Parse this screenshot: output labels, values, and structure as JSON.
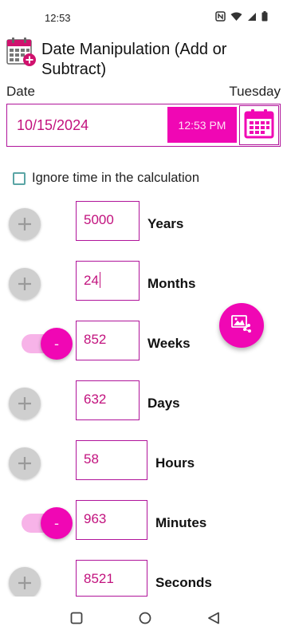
{
  "status_bar": {
    "time": "12:53",
    "icons": [
      "nfc-icon",
      "wifi-icon",
      "signal-icon",
      "battery-icon"
    ]
  },
  "header": {
    "title": "Date Manipulation (Add or Subtract)",
    "icon": "calendar-add-icon"
  },
  "date_section": {
    "label": "Date",
    "day_of_week": "Tuesday",
    "date_value": "10/15/2024",
    "time_value": "12:53 PM",
    "calendar_button_icon": "calendar-icon"
  },
  "ignore_time": {
    "label": "Ignore time in the calculation",
    "checked": false
  },
  "units": [
    {
      "label": "Years",
      "value": "5000",
      "mode": "add",
      "control_label": "+"
    },
    {
      "label": "Months",
      "value": "24",
      "mode": "add",
      "control_label": "+"
    },
    {
      "label": "Weeks",
      "value": "852",
      "mode": "subtract",
      "control_label": "-"
    },
    {
      "label": "Days",
      "value": "632",
      "mode": "add",
      "control_label": "+"
    },
    {
      "label": "Hours",
      "value": "58",
      "mode": "add",
      "control_label": "+"
    },
    {
      "label": "Minutes",
      "value": "963",
      "mode": "subtract",
      "control_label": "-"
    },
    {
      "label": "Seconds",
      "value": "8521",
      "mode": "add",
      "control_label": "+"
    }
  ],
  "fab": {
    "icon": "share-image-icon"
  },
  "nav_bar": {
    "icons": [
      "recents-square-icon",
      "home-circle-icon",
      "back-triangle-icon"
    ]
  },
  "colors": {
    "accent": "#f007b4",
    "border": "#b0149a",
    "text_accent": "#c2127e",
    "plus_grey": "#cfcfcf",
    "toggle_track": "#f7b3e8"
  }
}
